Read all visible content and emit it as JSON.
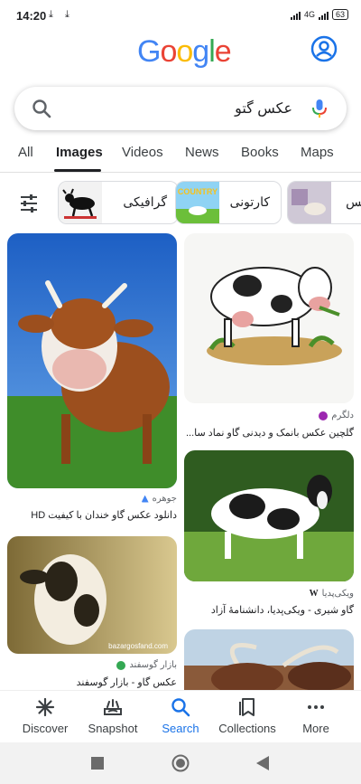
{
  "status": {
    "time": "14:20",
    "battery": "63",
    "network": "4G"
  },
  "logo": {
    "letters": [
      "G",
      "o",
      "o",
      "g",
      "l",
      "e"
    ],
    "colors": [
      "#4285F4",
      "#EA4335",
      "#FBBC05",
      "#4285F4",
      "#34A853",
      "#EA4335"
    ]
  },
  "search": {
    "query": "عکس گتو"
  },
  "tabs": [
    {
      "label": "All"
    },
    {
      "label": "Images"
    },
    {
      "label": "Videos"
    },
    {
      "label": "News"
    },
    {
      "label": "Books"
    },
    {
      "label": "Maps"
    }
  ],
  "chips": [
    {
      "label": "گرافیکی"
    },
    {
      "label": "کارتونی",
      "thumb_text": "COUNTRY"
    },
    {
      "label": "عکس"
    }
  ],
  "results": [
    {
      "source": "جوهره",
      "title": "دانلود عکس گاو خندان با کیفیت HD",
      "source_color": "#4285F4"
    },
    {
      "source": "دلگرم",
      "title": "گلچین عکس بانمک و دیدنی گاو نماد سا...",
      "source_color": "#9c27b0"
    },
    {
      "source": "ویکی‌پدیا",
      "title": "گاو شیری - ویکی‌پدیا، دانشنامهٔ آزاد",
      "source_color": "#202124",
      "source_glyph": "W"
    },
    {
      "source": "بازار گوسفند",
      "title": "عکس گاو - بازار گوسفند",
      "source_color": "#34A853",
      "watermark": "bazargosfand.com"
    }
  ],
  "nav": [
    {
      "label": "Discover"
    },
    {
      "label": "Snapshot"
    },
    {
      "label": "Search"
    },
    {
      "label": "Collections"
    },
    {
      "label": "More"
    }
  ],
  "accent": "#1a73e8"
}
